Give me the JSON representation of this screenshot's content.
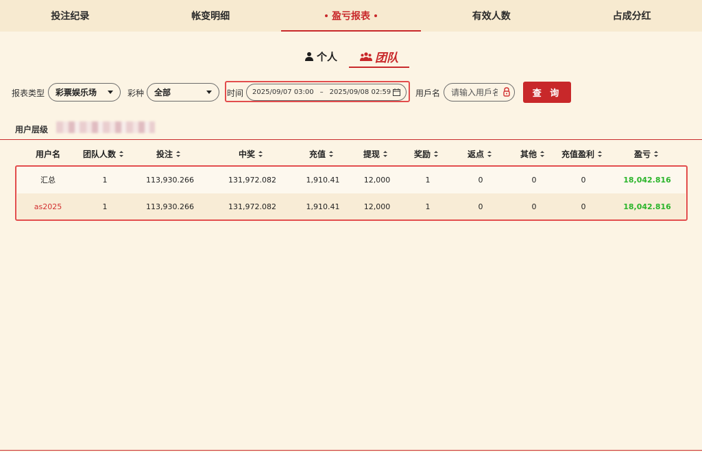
{
  "top_tabs": [
    {
      "label": "投注纪录"
    },
    {
      "label": "帐变明细"
    },
    {
      "label": "盈亏报表"
    },
    {
      "label": "有效人数"
    },
    {
      "label": "占成分红"
    }
  ],
  "mode_switch": {
    "personal": "个人",
    "team": "团队"
  },
  "filters": {
    "report_type_label": "报表类型",
    "report_type_value": "彩票娱乐场",
    "lottery_label": "彩种",
    "lottery_value": "全部",
    "time_label": "时间",
    "time_start": "2025/09/07 03:00",
    "time_sep": "–",
    "time_end": "2025/09/08 02:59",
    "username_label": "用戶名",
    "username_placeholder": "请输入用戶名",
    "query_label": "查 询"
  },
  "user_level_label": "用户层级",
  "table": {
    "headers": [
      "用户名",
      "团队人数",
      "投注",
      "中奖",
      "充值",
      "提现",
      "奖励",
      "返点",
      "其他",
      "充值盈利",
      "盈亏"
    ],
    "rows": [
      [
        "汇总",
        "1",
        "113,930.266",
        "131,972.082",
        "1,910.41",
        "12,000",
        "1",
        "0",
        "0",
        "0",
        "18,042.816"
      ],
      [
        "as2025",
        "1",
        "113,930.266",
        "131,972.082",
        "1,910.41",
        "12,000",
        "1",
        "0",
        "0",
        "0",
        "18,042.816"
      ]
    ]
  },
  "colors": {
    "accent": "#c8282a",
    "profit": "#2bb52b",
    "background": "#fcf4e4"
  }
}
